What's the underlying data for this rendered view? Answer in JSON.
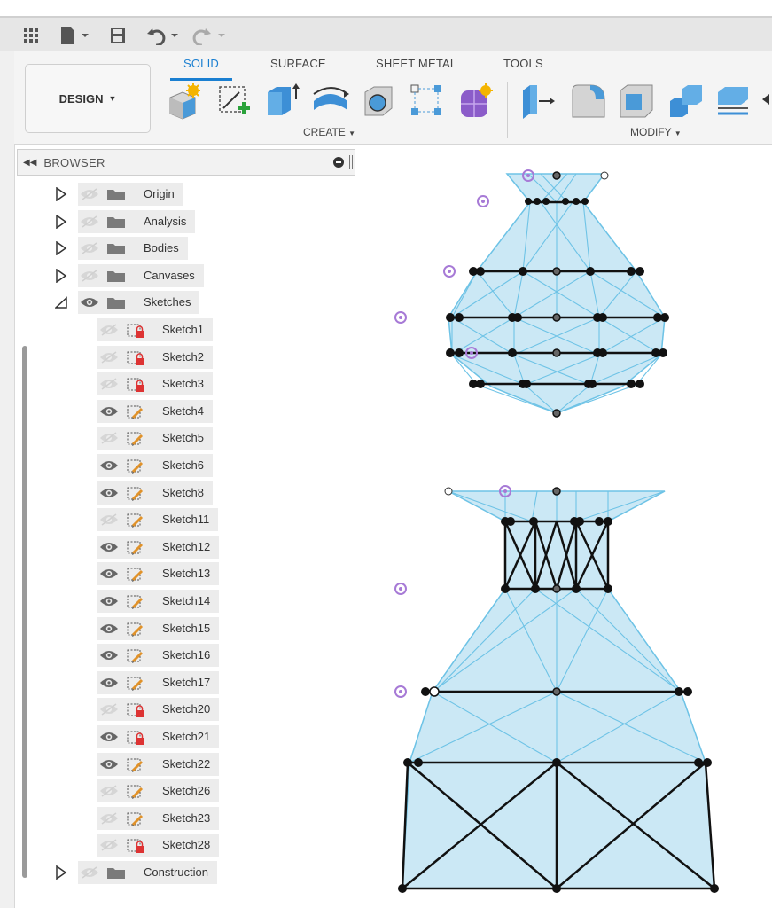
{
  "toolbar": {
    "icons": [
      "grid-icon",
      "file-icon",
      "save-icon",
      "undo-icon",
      "redo-icon"
    ]
  },
  "workspace": {
    "label": "DESIGN"
  },
  "tabs": [
    {
      "label": "SOLID",
      "active": true
    },
    {
      "label": "SURFACE",
      "active": false
    },
    {
      "label": "SHEET METAL",
      "active": false
    },
    {
      "label": "TOOLS",
      "active": false
    }
  ],
  "groups": {
    "create": "CREATE",
    "modify": "MODIFY"
  },
  "browser": {
    "title": "BROWSER",
    "folders_top": [
      {
        "label": "Origin",
        "visible": false,
        "expanded": false
      },
      {
        "label": "Analysis",
        "visible": false,
        "expanded": false
      },
      {
        "label": "Bodies",
        "visible": false,
        "expanded": false
      },
      {
        "label": "Canvases",
        "visible": false,
        "expanded": false
      },
      {
        "label": "Sketches",
        "visible": true,
        "expanded": true
      }
    ],
    "sketches": [
      {
        "label": "Sketch1",
        "visible": false,
        "locked": true
      },
      {
        "label": "Sketch2",
        "visible": false,
        "locked": true
      },
      {
        "label": "Sketch3",
        "visible": false,
        "locked": true
      },
      {
        "label": "Sketch4",
        "visible": true,
        "locked": false
      },
      {
        "label": "Sketch5",
        "visible": false,
        "locked": false
      },
      {
        "label": "Sketch6",
        "visible": true,
        "locked": false
      },
      {
        "label": "Sketch8",
        "visible": true,
        "locked": false
      },
      {
        "label": "Sketch11",
        "visible": false,
        "locked": false
      },
      {
        "label": "Sketch12",
        "visible": true,
        "locked": false
      },
      {
        "label": "Sketch13",
        "visible": true,
        "locked": false
      },
      {
        "label": "Sketch14",
        "visible": true,
        "locked": false
      },
      {
        "label": "Sketch15",
        "visible": true,
        "locked": false
      },
      {
        "label": "Sketch16",
        "visible": true,
        "locked": false
      },
      {
        "label": "Sketch17",
        "visible": true,
        "locked": false
      },
      {
        "label": "Sketch20",
        "visible": false,
        "locked": true
      },
      {
        "label": "Sketch21",
        "visible": true,
        "locked": true
      },
      {
        "label": "Sketch22",
        "visible": true,
        "locked": false
      },
      {
        "label": "Sketch26",
        "visible": false,
        "locked": false
      },
      {
        "label": "Sketch23",
        "visible": false,
        "locked": false
      },
      {
        "label": "Sketch28",
        "visible": false,
        "locked": true
      }
    ],
    "folders_bottom": [
      {
        "label": "Construction",
        "visible": false,
        "expanded": false
      }
    ]
  },
  "colors": {
    "accent": "#1a7fd1",
    "mesh_fill": "#cbe8f5",
    "mesh_line": "#6ec3e6",
    "sketch_line": "#111111",
    "constraint": "#a77ad6"
  }
}
